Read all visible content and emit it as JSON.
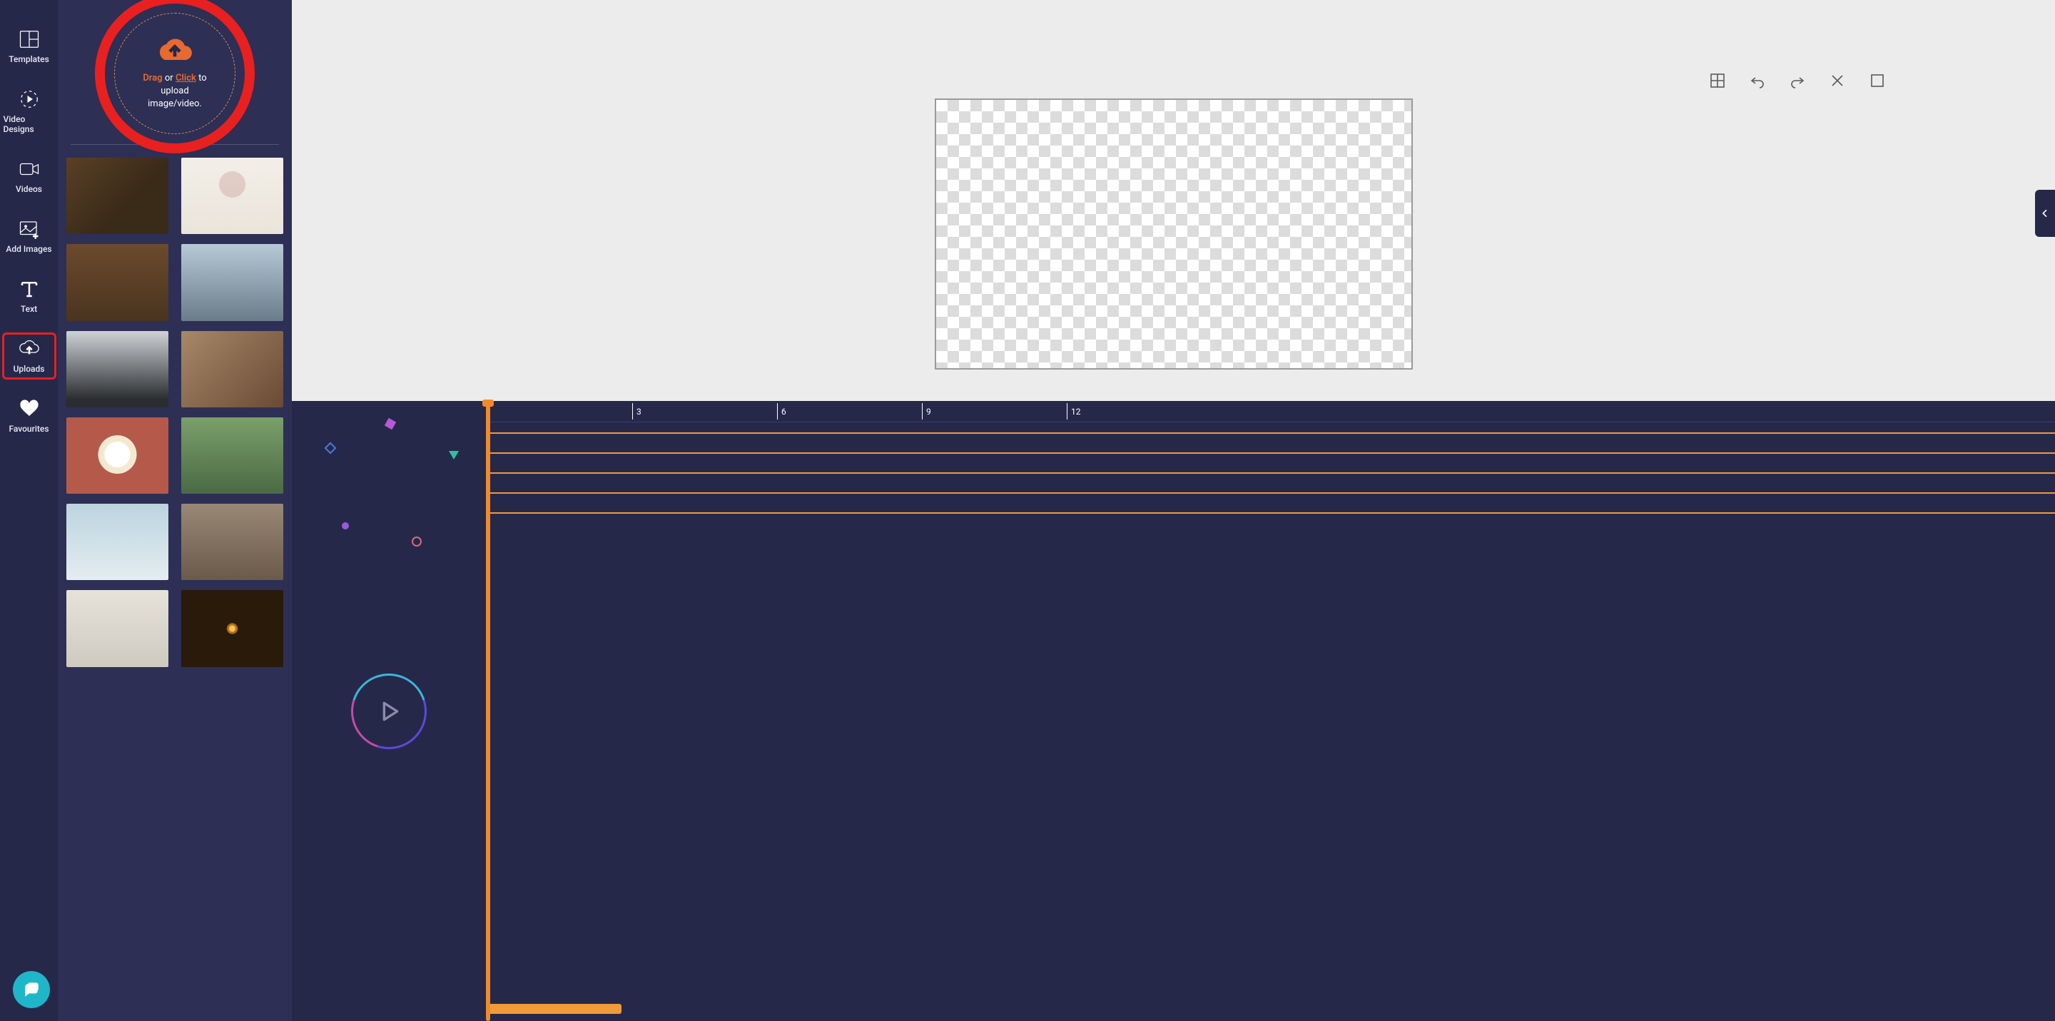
{
  "nav": {
    "items": [
      {
        "id": "templates",
        "label": "Templates"
      },
      {
        "id": "video-designs",
        "label": "Video Designs"
      },
      {
        "id": "videos",
        "label": "Videos"
      },
      {
        "id": "add-images",
        "label": "Add Images"
      },
      {
        "id": "text",
        "label": "Text"
      },
      {
        "id": "uploads",
        "label": "Uploads"
      },
      {
        "id": "favourites",
        "label": "Favourites"
      }
    ],
    "selected": "uploads"
  },
  "upload_drop": {
    "drag": "Drag",
    "or": "or",
    "click": "Click",
    "to": "to",
    "line2": "upload",
    "line3": "image/video."
  },
  "toolbar": {
    "grid_tip": "Grid",
    "undo_tip": "Undo",
    "redo_tip": "Redo",
    "close_tip": "Close",
    "fullscreen_tip": "Fullscreen"
  },
  "timeline": {
    "ticks": [
      3,
      6,
      9,
      12
    ],
    "playhead_seconds": 0
  },
  "colors": {
    "accent": "#f08a2a",
    "highlight": "#e92020",
    "bg": "#26284a",
    "panel": "#2d2f55"
  }
}
